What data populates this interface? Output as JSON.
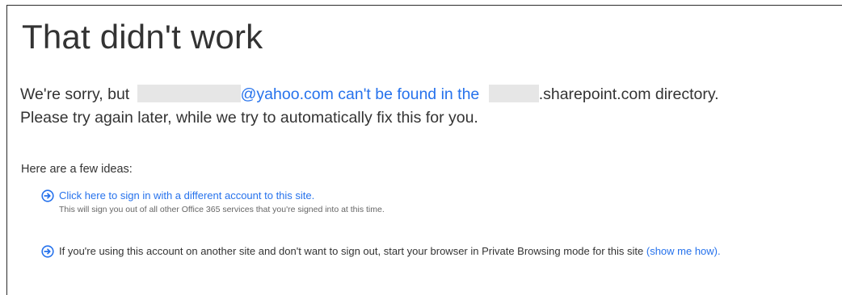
{
  "page": {
    "title": "That didn't work"
  },
  "message": {
    "prefix": "We're sorry, but",
    "email_domain": "@yahoo.com",
    "middle": "can't be found in the",
    "directory_suffix": ".sharepoint.com directory.",
    "line2": "Please try again later, while we try to automatically fix this for you."
  },
  "ideas": {
    "heading": "Here are a few ideas:",
    "items": [
      {
        "link_text": "Click here to sign in with a different account to this site.",
        "note": "This will sign you out of all other Office 365 services that you're signed into at this time."
      },
      {
        "text": "If you're using this account on another site and don't want to sign out, start your browser in Private Browsing mode for this site",
        "link_text": "(show me how)."
      }
    ]
  },
  "icons": {
    "idea_arrow": "circle-arrow-right-icon"
  },
  "colors": {
    "accent": "#2672ec",
    "text": "#333333",
    "redaction": "#e6e6e6"
  }
}
